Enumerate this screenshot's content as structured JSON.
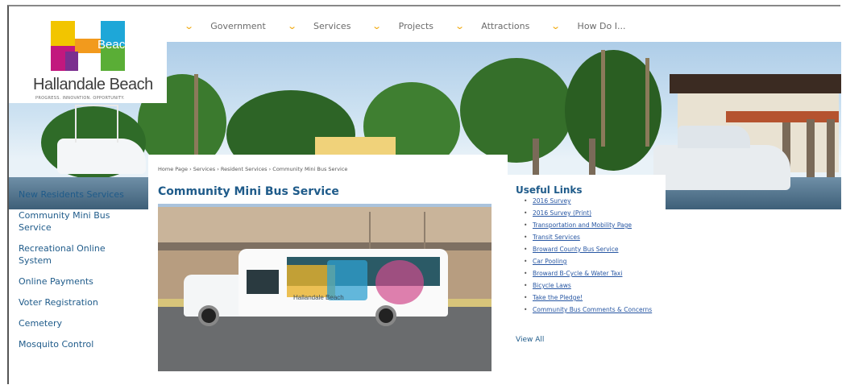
{
  "logo": {
    "mark_text": "Beach",
    "title": "Hallandale Beach",
    "tagline": "PROGRESS. INNOVATION. OPPORTUNITY."
  },
  "nav": {
    "items": [
      {
        "label": "Government"
      },
      {
        "label": "Services"
      },
      {
        "label": "Projects"
      },
      {
        "label": "Attractions"
      },
      {
        "label": "How Do I..."
      }
    ]
  },
  "breadcrumb": "Home Page › Services › Resident Services › Community Mini Bus Service",
  "page_title": "Community Mini Bus Service",
  "sidebar": {
    "items": [
      {
        "label": "New Residents Services"
      },
      {
        "label": "Community Mini Bus Service"
      },
      {
        "label": "Recreational Online System"
      },
      {
        "label": "Online Payments"
      },
      {
        "label": "Voter Registration"
      },
      {
        "label": "Cemetery"
      },
      {
        "label": "Mosquito Control"
      }
    ]
  },
  "photo": {
    "bus_brand": "Hallandale Beach"
  },
  "useful_links": {
    "title": "Useful Links",
    "items": [
      {
        "label": "2016 Survey"
      },
      {
        "label": "2016 Survey (Print)"
      },
      {
        "label": "Transportation and Mobility Page"
      },
      {
        "label": "Transit Services"
      },
      {
        "label": "Broward County Bus Service"
      },
      {
        "label": "Car Pooling"
      },
      {
        "label": "Broward B-Cycle & Water Taxi"
      },
      {
        "label": "Bicycle Laws"
      },
      {
        "label": "Take the Pledge!"
      },
      {
        "label": "Community Bus Comments & Concerns"
      }
    ],
    "view_all": "View All"
  },
  "colors": {
    "link_blue": "#1f5b8a",
    "nav_chevron": "#f0a500",
    "logo_yellow": "#f2c500",
    "logo_magenta": "#c2187e",
    "logo_cyan": "#1ea7d8",
    "logo_green": "#5aae36"
  }
}
